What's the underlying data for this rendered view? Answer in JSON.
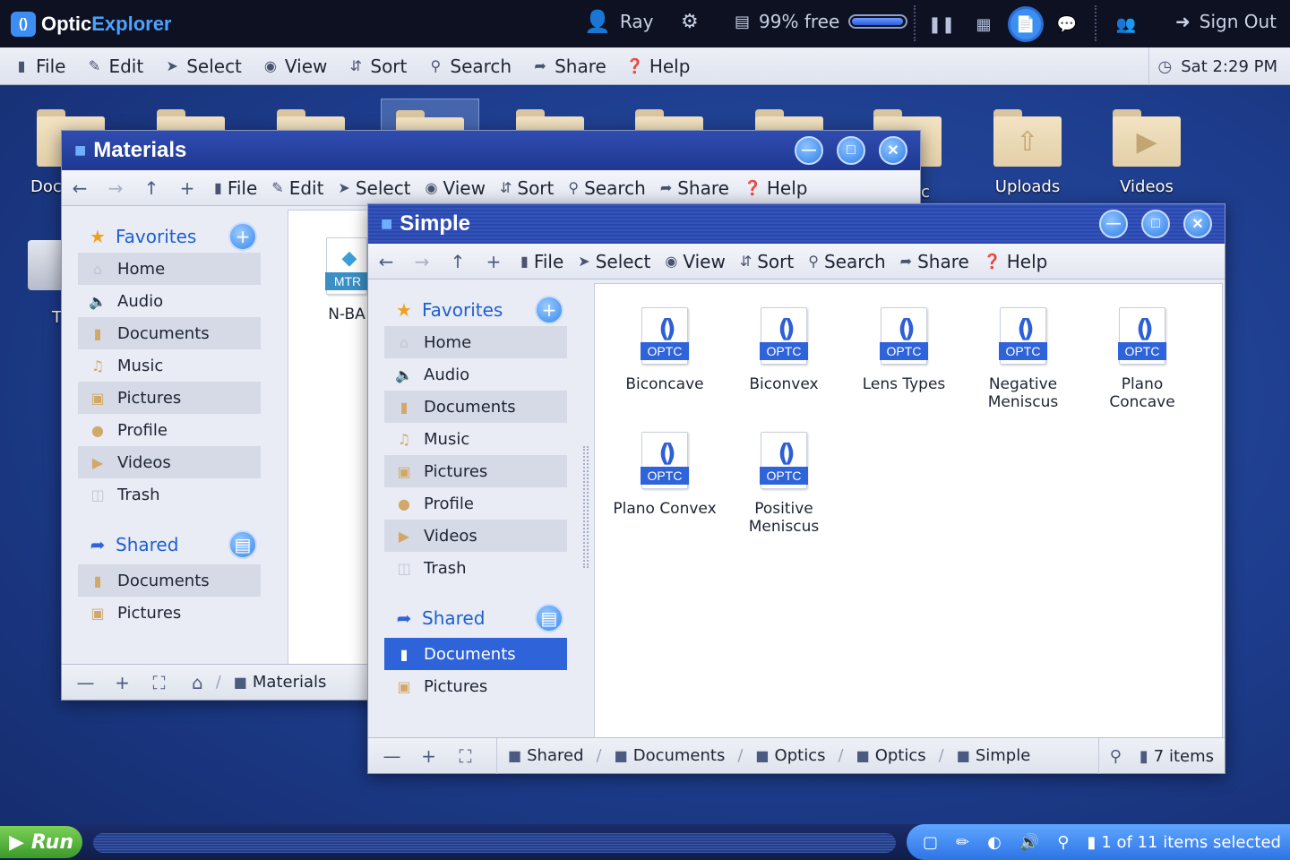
{
  "app": {
    "name_a": "Optic",
    "name_b": "Explorer",
    "logo_glyph": "()"
  },
  "topbar": {
    "user": "Ray",
    "storage": "99% free",
    "storage_fraction": 0.98,
    "sign_out": "Sign Out"
  },
  "menubar": {
    "items": [
      "File",
      "Edit",
      "Select",
      "View",
      "Sort",
      "Search",
      "Share",
      "Help"
    ],
    "clock": "Sat 2:29 PM"
  },
  "desktop": {
    "icons": [
      "Doc",
      "",
      "",
      "",
      "",
      "",
      "",
      "",
      "Uploads",
      "Videos"
    ],
    "labels": {
      "uploads": "Uploads",
      "videos": "Videos",
      "docs_partial": "Doc",
      "trash_partial": "T",
      "ic_partial": "c"
    }
  },
  "win_materials": {
    "title": "Materials",
    "toolbar": [
      "File",
      "Edit",
      "Select",
      "View",
      "Sort",
      "Search",
      "Share",
      "Help"
    ],
    "favorites_label": "Favorites",
    "favorites": [
      "Home",
      "Audio",
      "Documents",
      "Music",
      "Pictures",
      "Profile",
      "Videos",
      "Trash"
    ],
    "shared_label": "Shared",
    "shared": [
      "Documents",
      "Pictures"
    ],
    "file_partial": {
      "tag": "MTR",
      "name": "N-BA"
    },
    "crumb": "Materials"
  },
  "win_simple": {
    "title": "Simple",
    "toolbar": [
      "File",
      "Select",
      "View",
      "Sort",
      "Search",
      "Share",
      "Help"
    ],
    "favorites_label": "Favorites",
    "favorites": [
      "Home",
      "Audio",
      "Documents",
      "Music",
      "Pictures",
      "Profile",
      "Videos",
      "Trash"
    ],
    "shared_label": "Shared",
    "shared": [
      "Documents",
      "Pictures"
    ],
    "files": [
      {
        "l1": "Biconcave",
        "l2": ""
      },
      {
        "l1": "Biconvex",
        "l2": ""
      },
      {
        "l1": "Lens Types",
        "l2": ""
      },
      {
        "l1": "Negative",
        "l2": "Meniscus"
      },
      {
        "l1": "Plano",
        "l2": "Concave"
      },
      {
        "l1": "Plano Convex",
        "l2": ""
      },
      {
        "l1": "Positive",
        "l2": "Meniscus"
      }
    ],
    "file_tag": "OPTC",
    "breadcrumb": [
      "Shared",
      "Documents",
      "Optics",
      "Optics",
      "Simple"
    ],
    "item_count": "7 items"
  },
  "taskbar": {
    "run": "Run",
    "selection": "1 of 11 items selected"
  }
}
